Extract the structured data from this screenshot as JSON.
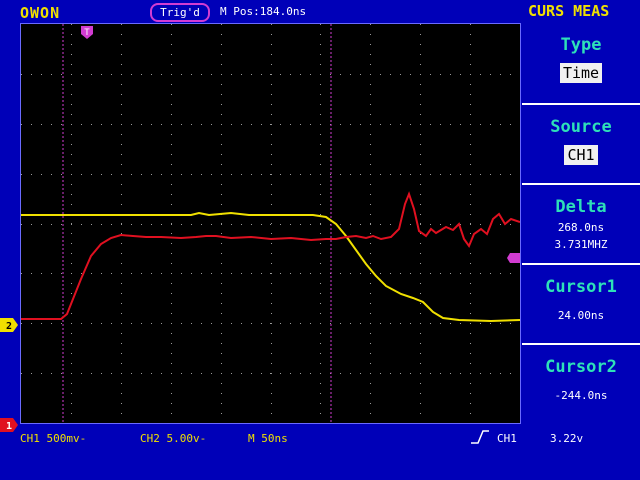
{
  "header": {
    "brand": "OWON",
    "trigger_status": "Trig'd",
    "m_pos": "M Pos:184.0ns",
    "mode_title": "CURS MEAS"
  },
  "menu": {
    "type": {
      "title": "Type",
      "value": "Time"
    },
    "source": {
      "title": "Source",
      "value": "CH1"
    },
    "delta": {
      "title": "Delta",
      "line1": "268.0ns",
      "line2": "3.731MHZ"
    },
    "cursor1": {
      "title": "Cursor1",
      "value": "24.00ns"
    },
    "cursor2": {
      "title": "Cursor2",
      "value": "-244.0ns"
    }
  },
  "footer": {
    "ch1_scale": "CH1  500mv-",
    "ch2_scale": "CH2  5.00v-",
    "timebase": "M 50ns",
    "trigger_source": "CH1",
    "trigger_level": "3.22v"
  },
  "markers": {
    "ch1": "1",
    "ch2": "2",
    "trigger_time": "T"
  },
  "colors": {
    "background": "#0000b8",
    "screen": "#000000",
    "ch1_trace": "#e01020",
    "ch2_trace": "#f0e000",
    "cursor": "#d23cd2",
    "menu_title": "#2ee0b8",
    "brand": "#f0e000"
  },
  "icons": {
    "trigger_slope": "rising-edge-icon"
  }
}
